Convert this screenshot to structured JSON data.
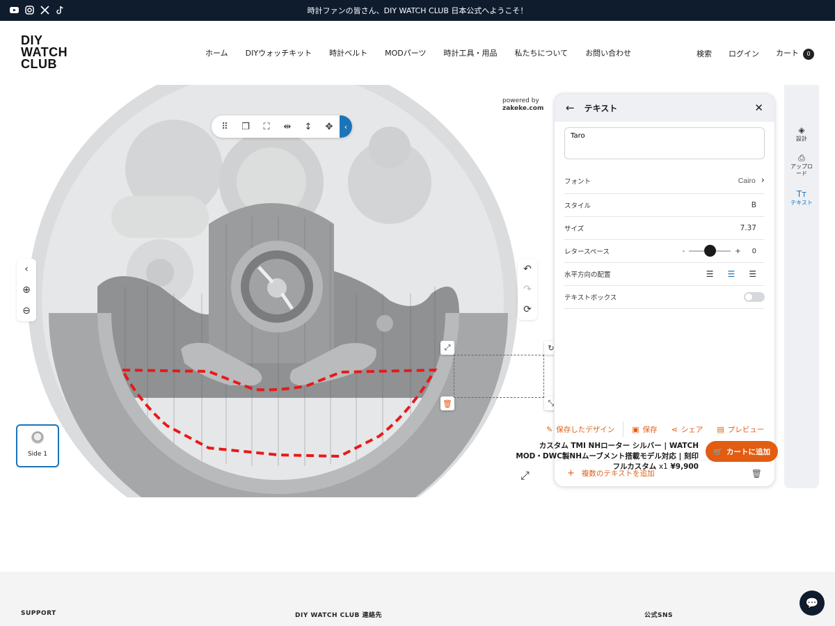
{
  "announcement": "時計ファンの皆さん、DIY WATCH CLUB 日本公式へようこそ！",
  "social": [
    "youtube-icon",
    "instagram-icon",
    "x-icon",
    "tiktok-icon"
  ],
  "logo": {
    "line1": "DIY",
    "line2": "WATCH",
    "line3": "CLUB"
  },
  "nav": [
    "ホーム",
    "DIYウォッチキット",
    "時計ベルト",
    "MODパーツ",
    "時計工具・用品",
    "私たちについて",
    "お問い合わせ"
  ],
  "header_right": {
    "search": "検索",
    "login": "ログイン",
    "cart": "カート",
    "cart_count": "0"
  },
  "powered": {
    "line1": "powered by",
    "line2": "zakeke.com"
  },
  "panel": {
    "title": "テキスト",
    "text_value": "Taro",
    "font_label": "フォント",
    "font_value": "Cairo",
    "style_label": "スタイル",
    "style_value": "B",
    "size_label": "サイズ",
    "size_value": "7.37",
    "spacing_label": "レタースペース",
    "spacing_minus": "-",
    "spacing_plus": "+",
    "spacing_value": "0",
    "spacing_slider_fraction": 0.5,
    "align_label": "水平方向の配置",
    "align_selected": "center",
    "textbox_label": "テキストボックス",
    "textbox_enabled": false,
    "add_multiple": "複数のテキストを追加"
  },
  "side_menu": [
    {
      "icon": "layers-icon",
      "label": "設計"
    },
    {
      "icon": "upload-icon",
      "label": "アップロード"
    },
    {
      "icon": "text-icon",
      "label": "テキスト"
    }
  ],
  "side_thumb": "Side 1",
  "actions": {
    "saved": "保存したデザイン",
    "save": "保存",
    "share": "シェア",
    "preview": "プレビュー"
  },
  "product": {
    "name": "カスタム TMI NHローター シルバー | WATCH MOD・DWC製NHムーブメント搭載モデル対応 | 刻印フルカスタム",
    "qty": "x1",
    "price": "¥9,900"
  },
  "add_to_cart": "カートに追加",
  "footer": {
    "col1": "SUPPORT",
    "col2": "DIY WATCH CLUB 連絡先",
    "col3": "公式SNS"
  },
  "colors": {
    "accent": "#e25d12",
    "brand_blue": "#1c74b8",
    "navy": "#0f1c2e"
  }
}
